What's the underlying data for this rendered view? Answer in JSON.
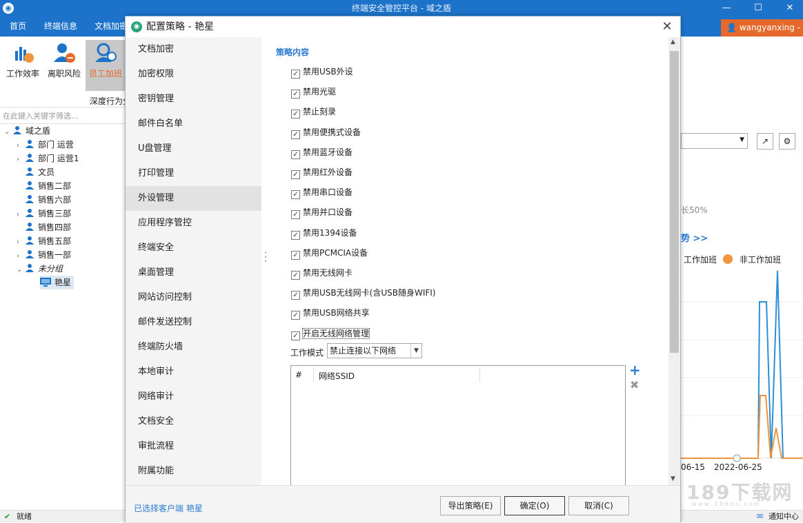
{
  "app": {
    "title": "终端安全管控平台 - 域之盾",
    "minimize": "—",
    "maximize": "☐",
    "close": "✕"
  },
  "menu": {
    "home": "首页",
    "terminal_info": "终端信息",
    "doc_encrypt": "文档加密"
  },
  "user": {
    "name": "wangyanxing",
    "arrow": "-"
  },
  "toolbar": {
    "efficiency": "工作效率",
    "resign": "离职风险",
    "overtime": "员工加班",
    "group_label": "深度行为分"
  },
  "search": {
    "placeholder": "在此键入关键字筛选..."
  },
  "tree": {
    "root": "域之盾",
    "items": [
      {
        "label": "部门 运营",
        "arrow": "›"
      },
      {
        "label": "部门 运营1",
        "arrow": "›"
      },
      {
        "label": "文员",
        "arrow": ""
      },
      {
        "label": "销售二部",
        "arrow": ""
      },
      {
        "label": "销售六部",
        "arrow": ""
      },
      {
        "label": "销售三部",
        "arrow": "›"
      },
      {
        "label": "销售四部",
        "arrow": ""
      },
      {
        "label": "销售五部",
        "arrow": "›"
      },
      {
        "label": "销售一部",
        "arrow": "›"
      },
      {
        "label": "未分组",
        "arrow": "⌄"
      }
    ],
    "leaf": "艳星"
  },
  "status": {
    "ready": "就绪",
    "notify": "通知中心"
  },
  "background": {
    "pct_text": "长50%",
    "trend_text": "势 >>",
    "legend1": "工作加班",
    "legend2": "非工作加班",
    "date1": "06-15",
    "date2": "2022-06-25",
    "watermark": "189下载网",
    "watermark_sub": "w w w . 1 8 9 d o . c o m",
    "colors": {
      "series1": "#2a8fd6",
      "series2": "#f0953a"
    }
  },
  "dialog": {
    "title": "配置策略 - 艳星",
    "close": "✕",
    "nav": [
      "文档加密",
      "加密权限",
      "密钥管理",
      "邮件白名单",
      "U盘管理",
      "打印管理",
      "外设管理",
      "应用程序管控",
      "终端安全",
      "桌面管理",
      "网站访问控制",
      "邮件发送控制",
      "终端防火墙",
      "本地审计",
      "网络审计",
      "文档安全",
      "审批流程",
      "附属功能"
    ],
    "nav_active_index": 6,
    "section_title": "策略内容",
    "checkboxes": [
      {
        "label": "禁用USB外设",
        "checked": true
      },
      {
        "label": "禁用光驱",
        "checked": true
      },
      {
        "label": "禁止刻录",
        "checked": true
      },
      {
        "label": "禁用便携式设备",
        "checked": true
      },
      {
        "label": "禁用蓝牙设备",
        "checked": true
      },
      {
        "label": "禁用红外设备",
        "checked": true
      },
      {
        "label": "禁用串口设备",
        "checked": true
      },
      {
        "label": "禁用并口设备",
        "checked": true
      },
      {
        "label": "禁用1394设备",
        "checked": true
      },
      {
        "label": "禁用PCMCIA设备",
        "checked": true
      },
      {
        "label": "禁用无线网卡",
        "checked": true
      },
      {
        "label": "禁用USB无线网卡(含USB随身WIFI)",
        "checked": true
      },
      {
        "label": "禁用USB网络共享",
        "checked": true
      },
      {
        "label": "开启无线网络管理",
        "checked": true
      }
    ],
    "mode_label": "工作模式",
    "mode_value": "禁止连接以下网络",
    "grid_headers": [
      "#",
      "网络SSID"
    ],
    "add_icon": "+",
    "delete_icon": "✖",
    "selected_client": "已选择客户端 艳星",
    "buttons": {
      "export": "导出策略(E)",
      "ok": "确定(O)",
      "cancel": "取消(C)"
    }
  }
}
